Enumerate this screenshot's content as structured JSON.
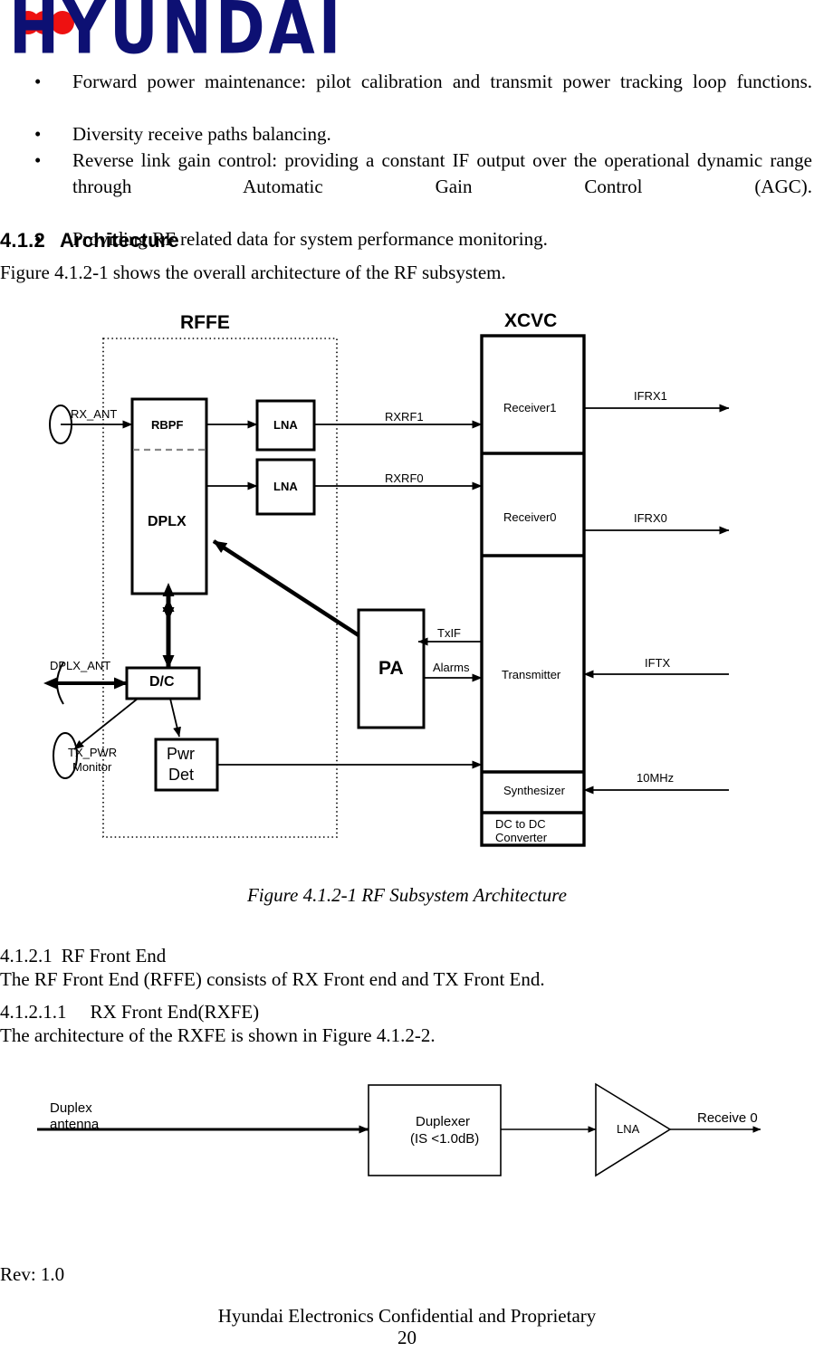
{
  "logo": {
    "wordmark": "HYUNDAI",
    "navy": "#0d1073",
    "red": "#ee1111"
  },
  "bullets": [
    "Forward power maintenance: pilot calibration and transmit power tracking loop functions.",
    "Diversity receive paths balancing.",
    "Reverse link gain control: providing a constant IF output over the operational dynamic range through Automatic Gain Control (AGC).",
    "Providing RF related data for system performance monitoring."
  ],
  "bullet_marker": "•",
  "sections": {
    "architecture": {
      "number": "4.1.2",
      "title": "Architecture",
      "body": "Figure 4.1.2-1 shows the overall architecture of the RF subsystem."
    },
    "rf_front_end": {
      "number": "4.1.2.1",
      "title": "RF Front End",
      "body": "The RF Front End (RFFE) consists of RX Front end and TX Front End."
    },
    "rx_front_end": {
      "number": "4.1.2.1.1",
      "title": "RX Front End(RXFE)",
      "body": "The architecture of the RXFE is shown in Figure 4.1.2-2."
    }
  },
  "figure1": {
    "caption": "Figure 4.1.2-1 RF Subsystem Architecture",
    "group_labels": {
      "rffe": "RFFE",
      "xcvc": "XCVC"
    },
    "blocks": {
      "rbpf": "RBPF",
      "dplx": "DPLX",
      "lna_top": "LNA",
      "lna_bottom": "LNA",
      "dc": "D/C",
      "pwr_det_line1": "Pwr",
      "pwr_det_line2": "Det",
      "pa": "PA",
      "receiver1": "Receiver1",
      "receiver0": "Receiver0",
      "transmitter": "Transmitter",
      "synthesizer": "Synthesizer",
      "dcdc_line1": "DC to DC",
      "dcdc_line2": "Converter"
    },
    "ports": {
      "rx_ant": "RX_ANT",
      "dplx_ant": "DPLX_ANT",
      "tx_pwr_line1": "TX_PWR",
      "tx_pwr_line2": "Monitor"
    },
    "signals": {
      "rxrf1": "RXRF1",
      "rxrf0": "RXRF0",
      "ifrx1": "IFRX1",
      "ifrx0": "IFRX0",
      "txif": "TxIF",
      "alarms": "Alarms",
      "iftx": "IFTX",
      "ref10mhz": "10MHz"
    }
  },
  "figure2": {
    "antenna_line1": "Duplex",
    "antenna_line2": "antenna",
    "duplexer_line1": "Duplexer",
    "duplexer_line2": "(IS <1.0dB)",
    "lna": "LNA",
    "output": "Receive  0"
  },
  "footer": {
    "rev": "Rev: 1.0",
    "confidential": "Hyundai Electronics Confidential and Proprietary",
    "page": "20"
  }
}
